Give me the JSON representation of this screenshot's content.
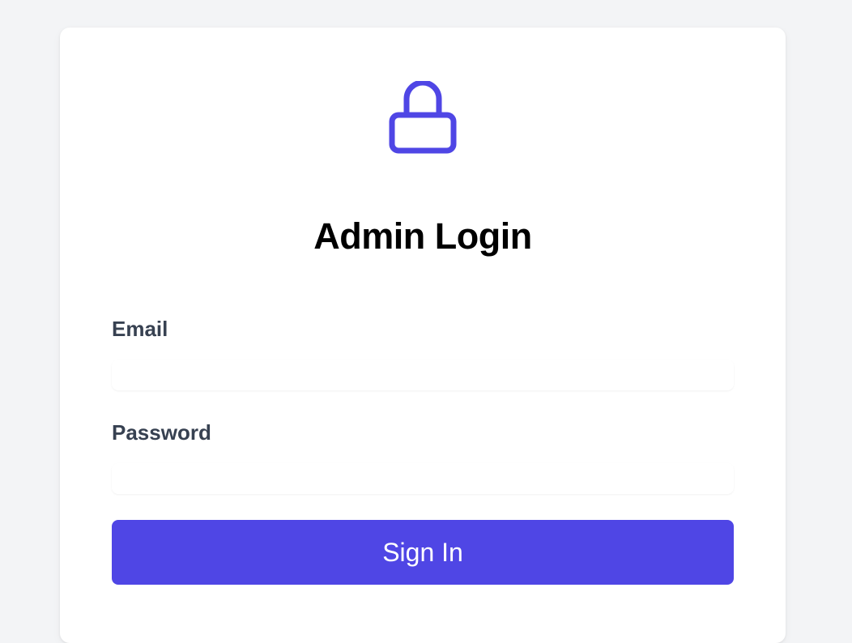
{
  "login": {
    "title": "Admin Login",
    "email_label": "Email",
    "email_value": "",
    "password_label": "Password",
    "password_value": "",
    "signin_label": "Sign In"
  },
  "icons": {
    "header_icon": "lock-icon"
  },
  "colors": {
    "accent": "#4f46e5",
    "background": "#f3f4f6",
    "card": "#ffffff",
    "label_text": "#374151",
    "title_text": "#000000"
  }
}
